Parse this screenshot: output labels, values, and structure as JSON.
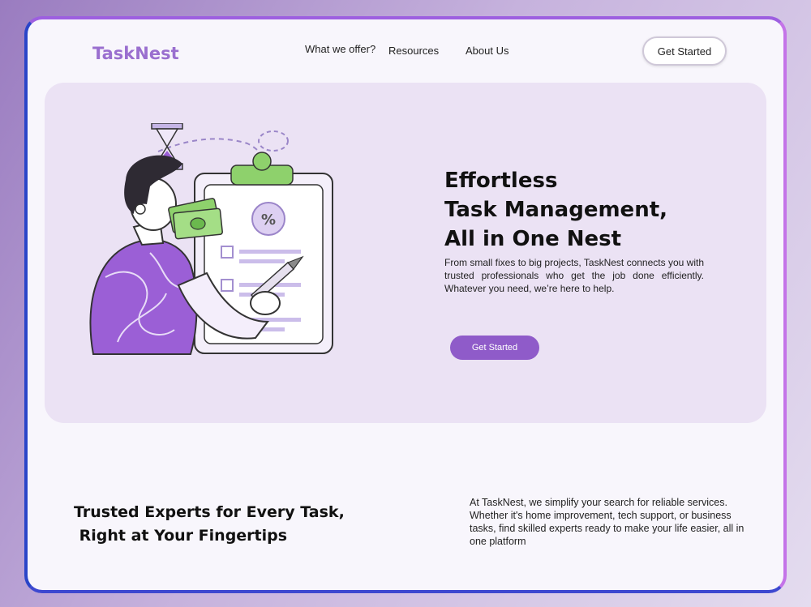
{
  "brand": {
    "name": "TaskNest"
  },
  "nav": {
    "items": [
      "What we offer?",
      "Resources",
      "About Us"
    ],
    "cta": "Get Started"
  },
  "hero": {
    "title_lines": [
      "Effortless",
      "Task Management,",
      "All in One Nest"
    ],
    "description": "From small fixes to big projects, TaskNest connects you with trusted professionals who get the job done efficiently. Whatever you need, we’re here to help.",
    "cta": "Get Started"
  },
  "section": {
    "title_lines": [
      "Trusted Experts for Every Task,",
      " Right at Your Fingertips"
    ],
    "description": "At TaskNest, we simplify your search for reliable services. Whether it's home improvement, tech support, or business tasks, find skilled experts ready to make your life easier, all in one platform"
  },
  "colors": {
    "brand_purple": "#9a6fcf",
    "button_purple": "#8f5bc9",
    "hero_bg": "#ebe2f4",
    "illustration_purple": "#9b5fd6",
    "illustration_green": "#8ed16c"
  },
  "icons": [
    "hourglass-icon",
    "clipboard-icon",
    "percent-icon",
    "money-icon",
    "pen-icon"
  ]
}
